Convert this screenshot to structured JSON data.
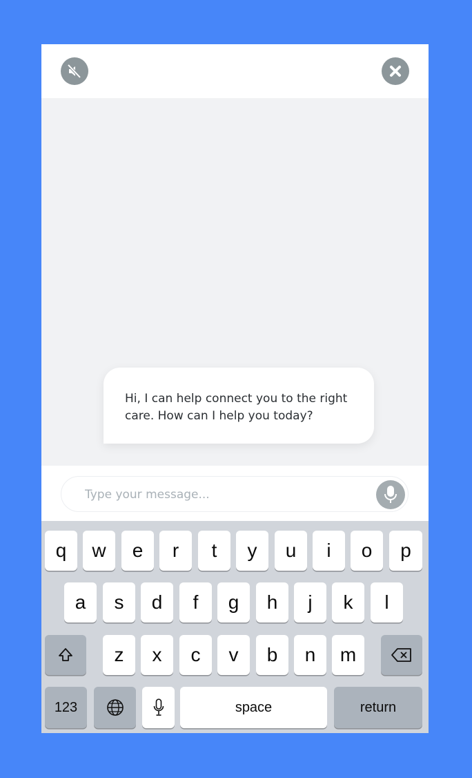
{
  "header": {
    "mute_icon": "speaker-muted-icon",
    "close_icon": "close-circle-icon"
  },
  "chat": {
    "messages": [
      {
        "sender": "bot",
        "text": "Hi, I can help connect you to the right care. How can I help you today?"
      }
    ]
  },
  "composer": {
    "placeholder": "Type your message...",
    "mic_icon": "microphone-icon"
  },
  "keyboard": {
    "row1": [
      "q",
      "w",
      "e",
      "r",
      "t",
      "y",
      "u",
      "i",
      "o",
      "p"
    ],
    "row2": [
      "a",
      "s",
      "d",
      "f",
      "g",
      "h",
      "j",
      "k",
      "l"
    ],
    "row3": [
      "z",
      "x",
      "c",
      "v",
      "b",
      "n",
      "m"
    ],
    "numbers_label": "123",
    "space_label": "space",
    "return_label": "return",
    "shift_icon": "shift-icon",
    "backspace_icon": "backspace-icon",
    "globe_icon": "globe-icon",
    "dictation_icon": "microphone-icon"
  },
  "colors": {
    "background": "#4786f9",
    "icon_gray": "#8c969a",
    "bubble": "#ffffff",
    "keyboard": "#d1d5db"
  }
}
